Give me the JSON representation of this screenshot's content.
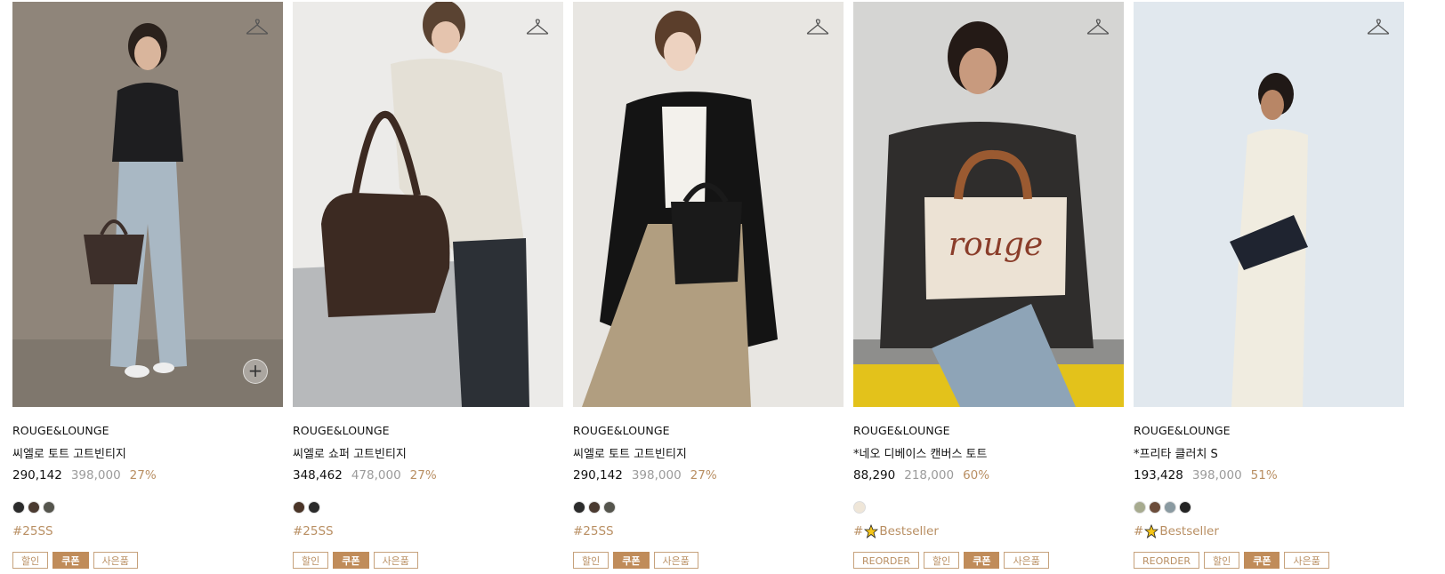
{
  "products": [
    {
      "brand": "ROUGE&LOUNGE",
      "name": "씨엘로 토트 고트빈티지",
      "price": "290,142",
      "original_price": "398,000",
      "discount": "27%",
      "swatches": [
        "#2b2b2b",
        "#4a3a30",
        "#55554d"
      ],
      "tag": "#25SS",
      "tag_icon": "",
      "badges": [
        "할인",
        "쿠폰",
        "사은품"
      ],
      "badge_filled": [
        false,
        true,
        false
      ],
      "has_plus": true,
      "bg": "#8e8478"
    },
    {
      "brand": "ROUGE&LOUNGE",
      "name": "씨엘로 쇼퍼 고트빈티지",
      "price": "348,462",
      "original_price": "478,000",
      "discount": "27%",
      "swatches": [
        "#4a3427",
        "#2a2a2a"
      ],
      "tag": "#25SS",
      "tag_icon": "",
      "badges": [
        "할인",
        "쿠폰",
        "사은품"
      ],
      "badge_filled": [
        false,
        true,
        false
      ],
      "has_plus": false,
      "bg": "#e9e8e6"
    },
    {
      "brand": "ROUGE&LOUNGE",
      "name": "씨엘로 토트 고트빈티지",
      "price": "290,142",
      "original_price": "398,000",
      "discount": "27%",
      "swatches": [
        "#2b2b2b",
        "#4a3a30",
        "#55554d"
      ],
      "tag": "#25SS",
      "tag_icon": "",
      "badges": [
        "할인",
        "쿠폰",
        "사은품"
      ],
      "badge_filled": [
        false,
        true,
        false
      ],
      "has_plus": false,
      "bg": "#e6e4e0"
    },
    {
      "brand": "ROUGE&LOUNGE",
      "name": "*네오 디베이스 캔버스 토트",
      "price": "88,290",
      "original_price": "218,000",
      "discount": "60%",
      "swatches": [
        "#efe6d8"
      ],
      "tag": "Bestseller",
      "tag_icon": "star-bee-icon",
      "badges": [
        "REORDER",
        "할인",
        "쿠폰",
        "사은품"
      ],
      "badge_filled": [
        false,
        false,
        true,
        false
      ],
      "has_plus": false,
      "bg": "#d9d9d6"
    },
    {
      "brand": "ROUGE&LOUNGE",
      "name": "*프리타 클러치 S",
      "price": "193,428",
      "original_price": "398,000",
      "discount": "51%",
      "swatches": [
        "#a7ab8f",
        "#6b4c3a",
        "#8a9aa1",
        "#232323"
      ],
      "tag": "Bestseller",
      "tag_icon": "star-bee-icon",
      "badges": [
        "REORDER",
        "할인",
        "쿠폰",
        "사은품"
      ],
      "badge_filled": [
        false,
        false,
        true,
        false
      ],
      "has_plus": false,
      "bg": "#dfe6ec"
    }
  ],
  "icons": {
    "wishlist": "hanger-icon",
    "quick_add": "plus-icon"
  },
  "colors": {
    "accent": "#c08c5a",
    "discount": "#b98f63",
    "muted": "#9b9b9b"
  }
}
